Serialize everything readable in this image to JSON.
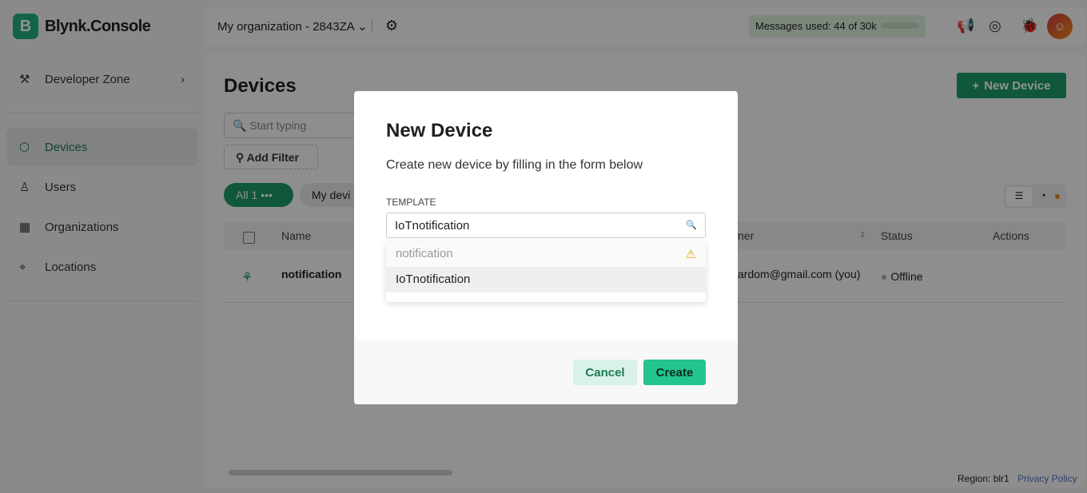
{
  "app": {
    "brand_letter": "B",
    "brand": "Blynk.Console"
  },
  "header": {
    "org": "My organization - 2843ZA",
    "messages": "Messages used: 44 of 30k",
    "messages_fraction": 0.0015
  },
  "sidebar": {
    "developer_zone": "Developer Zone",
    "items": [
      {
        "label": "Devices",
        "icon": "cube-icon"
      },
      {
        "label": "Users",
        "icon": "users-icon"
      },
      {
        "label": "Organizations",
        "icon": "building-icon"
      },
      {
        "label": "Locations",
        "icon": "pin-icon"
      }
    ]
  },
  "main": {
    "title": "Devices",
    "new_device": "New Device",
    "search_placeholder": "Start typing",
    "add_filter": "Add Filter",
    "pills": {
      "all": "All",
      "all_count": "1",
      "my": "My devi"
    },
    "table": {
      "headers": {
        "name": "Name",
        "owner": "ner",
        "status": "Status",
        "actions": "Actions"
      },
      "rows": [
        {
          "name": "notification",
          "owner": "ardom@gmail.com (you)",
          "status": "Offline"
        }
      ]
    }
  },
  "footer": {
    "region": "Region: blr1",
    "privacy": "Privacy Policy"
  },
  "modal": {
    "title": "New Device",
    "subtitle": "Create new device by filling in the form below",
    "template_label": "TEMPLATE",
    "template_value": "IoTnotification",
    "options": [
      "notification",
      "IoTnotification"
    ],
    "cancel": "Cancel",
    "create": "Create"
  }
}
